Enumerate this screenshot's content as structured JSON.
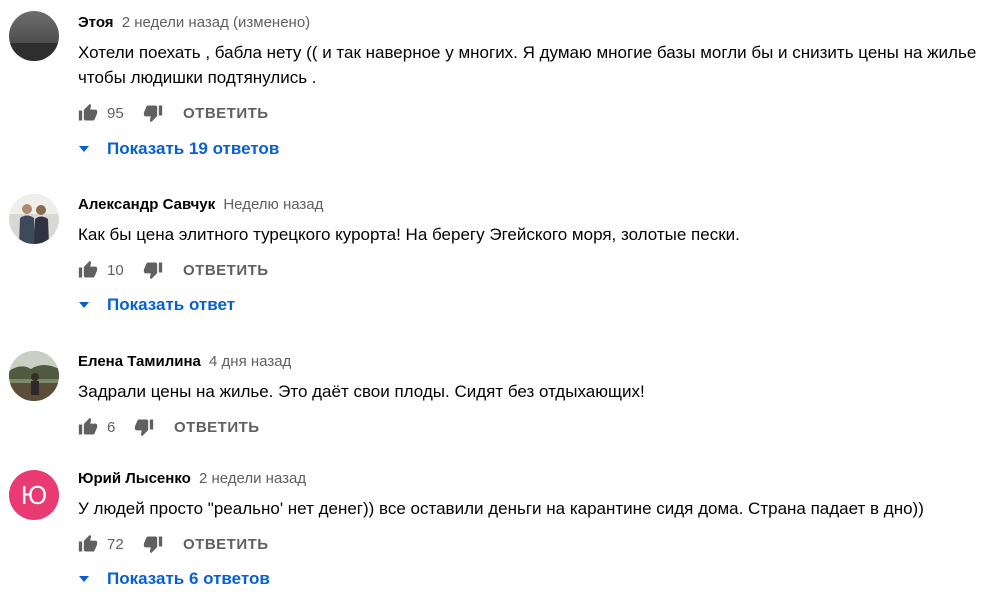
{
  "comments": [
    {
      "author": "Этоя",
      "time": "2 недели назад (изменено)",
      "text_lines": [
        "Хотели поехать , бабла нету (( и так наверное у многих. Я думаю многие базы могли бы и снизить цены на жилье",
        "чтобы людишки подтянулись ."
      ],
      "likes": "95",
      "reply_label": "ОТВЕТИТЬ",
      "replies_label": "Показать 19 ответов"
    },
    {
      "author": "Александр Савчук",
      "time": "Неделю назад",
      "text_lines": [
        "Как бы цена элитного турецкого курорта! На берегу Эгейского моря, золотые пески."
      ],
      "likes": "10",
      "reply_label": "ОТВЕТИТЬ",
      "replies_label": "Показать ответ"
    },
    {
      "author": "Елена Тамилина",
      "time": "4 дня назад",
      "text_lines": [
        "Задрали цены на жилье. Это даёт свои плоды. Сидят без отдыхающих!"
      ],
      "likes": "6",
      "reply_label": "ОТВЕТИТЬ"
    },
    {
      "author": "Юрий Лысенко",
      "time": "2 недели назад",
      "avatar_letter": "Ю",
      "avatar_color": "#e93a74",
      "text_lines": [
        "У людей просто \"реально' нет денег)) все оставили деньги на карантине сидя дома. Страна падает в дно))"
      ],
      "likes": "72",
      "reply_label": "ОТВЕТИТЬ",
      "replies_label": "Показать 6 ответов"
    }
  ],
  "colors": {
    "link": "#065fd4",
    "secondary_text": "#606060",
    "primary_text": "#030303"
  },
  "icons": {
    "like": "thumb-up-icon",
    "dislike": "thumb-down-icon",
    "expand": "caret-down-icon"
  }
}
